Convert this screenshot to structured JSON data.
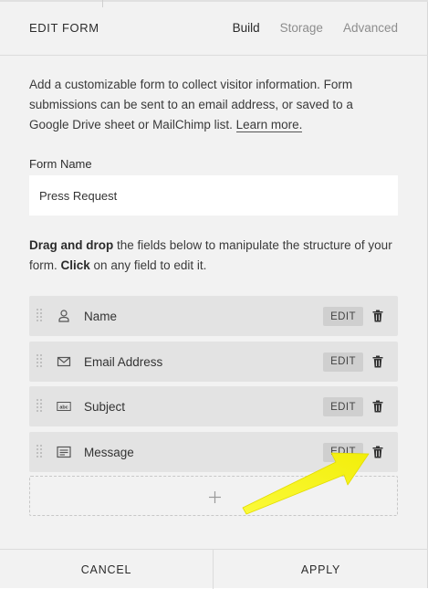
{
  "header": {
    "title": "EDIT FORM",
    "tabs": [
      "Build",
      "Storage",
      "Advanced"
    ],
    "active_tab": "Build"
  },
  "description": {
    "text": "Add a customizable form to collect visitor information. Form submissions can be sent to an email address, or saved to a Google Drive sheet or MailChimp list.",
    "link": "Learn more."
  },
  "form_name": {
    "label": "Form Name",
    "value": "Press Request"
  },
  "instructions": {
    "bold1": "Drag and drop",
    "text1": " the fields below to manipulate the structure of your form. ",
    "bold2": "Click",
    "text2": " on any field to edit it."
  },
  "fields": [
    {
      "label": "Name",
      "icon": "person-icon",
      "edit": "EDIT"
    },
    {
      "label": "Email Address",
      "icon": "envelope-icon",
      "edit": "EDIT"
    },
    {
      "label": "Subject",
      "icon": "text-field-icon",
      "edit": "EDIT"
    },
    {
      "label": "Message",
      "icon": "textarea-icon",
      "edit": "EDIT"
    }
  ],
  "footer": {
    "cancel": "CANCEL",
    "apply": "APPLY"
  },
  "colors": {
    "panel_bg": "#f2f2f2",
    "row_bg": "#e3e3e3",
    "edit_bg": "#cfcfcf",
    "arrow": "#f7f51f"
  }
}
